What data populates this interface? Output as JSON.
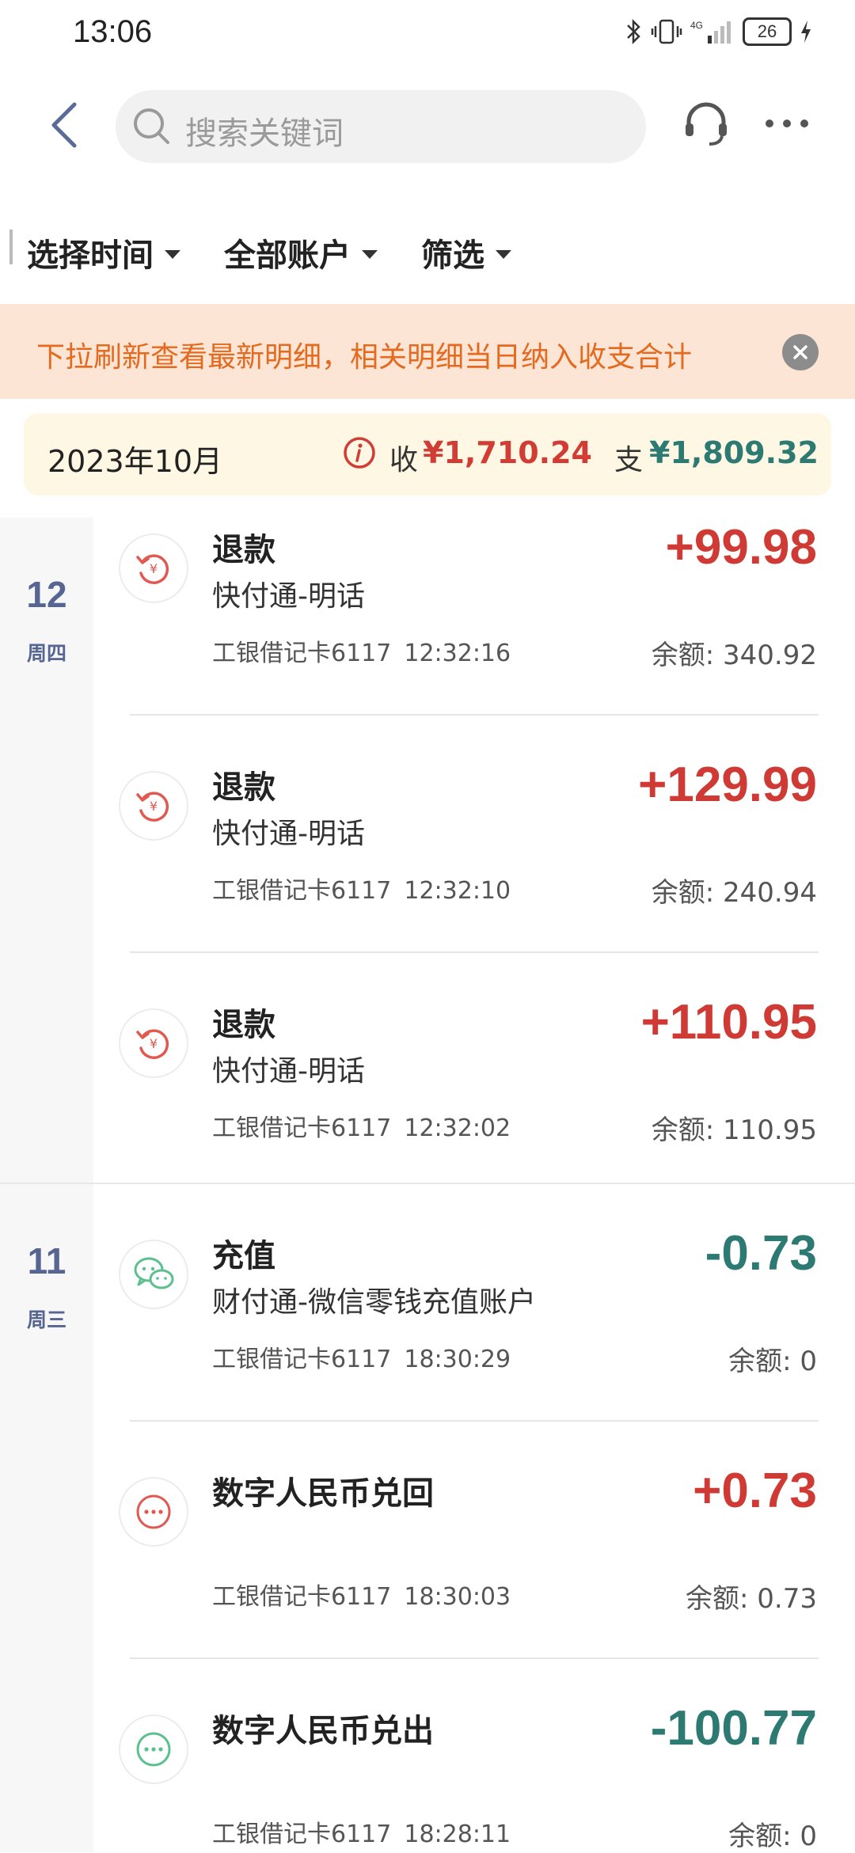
{
  "status_bar": {
    "time": "13:06",
    "battery": "26",
    "network": "4G"
  },
  "search": {
    "placeholder": "搜索关键词"
  },
  "filters": [
    {
      "label": "选择时间"
    },
    {
      "label": "全部账户"
    },
    {
      "label": "筛选"
    }
  ],
  "notice": {
    "text": "下拉刷新查看最新明细，相关明细当日纳入收支合计"
  },
  "summary": {
    "month": "2023年10月",
    "income_label": "收",
    "income_value": "¥1,710.24",
    "expense_label": "支",
    "expense_value": "¥1,809.32"
  },
  "colors": {
    "income": "#cf3b34",
    "expense": "#2d7a72",
    "notice_bg": "#fde5d5",
    "notice_text": "#e36a1f",
    "summary_bg": "#fdf7e4",
    "day_label": "#566591"
  },
  "groups": [
    {
      "day": "12",
      "weekday": "周四",
      "transactions": [
        {
          "icon": "refund-icon",
          "title": "退款",
          "merchant": "快付通-明话",
          "card": "工银借记卡6117",
          "time": "12:32:16",
          "amount": "+99.98",
          "direction": "in",
          "balance": "余额: 340.92"
        },
        {
          "icon": "refund-icon",
          "title": "退款",
          "merchant": "快付通-明话",
          "card": "工银借记卡6117",
          "time": "12:32:10",
          "amount": "+129.99",
          "direction": "in",
          "balance": "余额: 240.94"
        },
        {
          "icon": "refund-icon",
          "title": "退款",
          "merchant": "快付通-明话",
          "card": "工银借记卡6117",
          "time": "12:32:02",
          "amount": "+110.95",
          "direction": "in",
          "balance": "余额: 110.95"
        }
      ]
    },
    {
      "day": "11",
      "weekday": "周三",
      "transactions": [
        {
          "icon": "wechat-icon",
          "title": "充值",
          "merchant": "财付通-微信零钱充值账户",
          "card": "工银借记卡6117",
          "time": "18:30:29",
          "amount": "-0.73",
          "direction": "out",
          "balance": "余额: 0"
        },
        {
          "icon": "more-dots-icon",
          "title": "数字人民币兑回",
          "merchant": "",
          "card": "工银借记卡6117",
          "time": "18:30:03",
          "amount": "+0.73",
          "direction": "in",
          "balance": "余额: 0.73"
        },
        {
          "icon": "more-dots-icon",
          "title": "数字人民币兑出",
          "merchant": "",
          "card": "工银借记卡6117",
          "time": "18:28:11",
          "amount": "-100.77",
          "direction": "out",
          "balance": "余额: 0"
        }
      ]
    }
  ]
}
